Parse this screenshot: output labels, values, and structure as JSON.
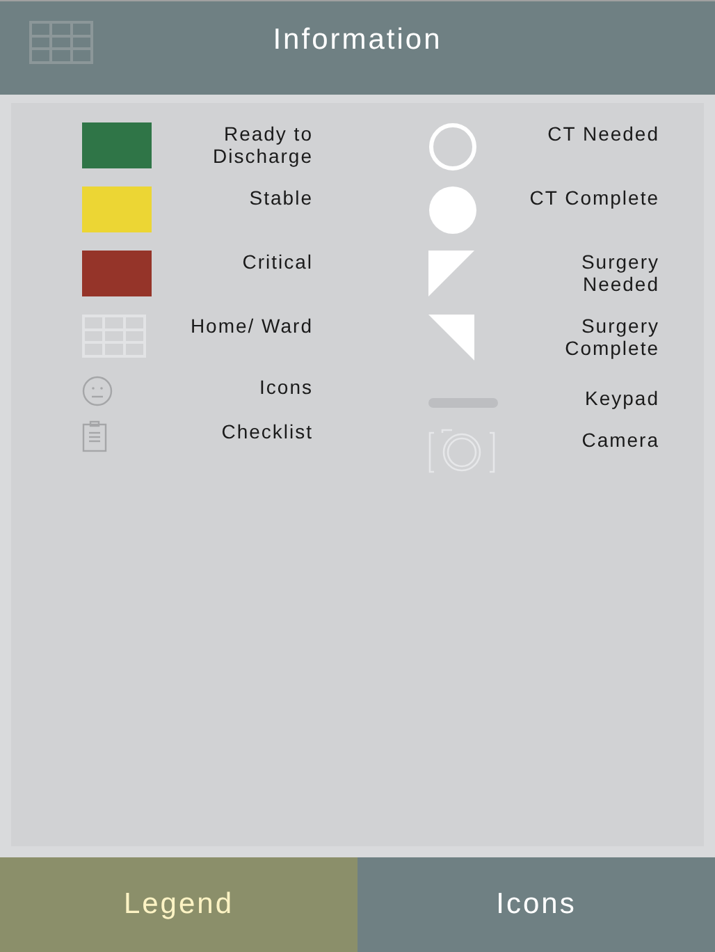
{
  "header": {
    "title": "Information"
  },
  "legend": {
    "left": [
      {
        "kind": "swatch",
        "color": "#2f7547",
        "label": "Ready to Discharge"
      },
      {
        "kind": "swatch",
        "color": "#ecd634",
        "label": "Stable"
      },
      {
        "kind": "swatch",
        "color": "#953429",
        "label": "Critical"
      },
      {
        "kind": "grid",
        "label": "Home/ Ward"
      },
      {
        "kind": "face",
        "label": "Icons"
      },
      {
        "kind": "clipboard",
        "label": "Checklist"
      }
    ],
    "right": [
      {
        "kind": "ring",
        "label": "CT Needed"
      },
      {
        "kind": "disc",
        "label": "CT Complete"
      },
      {
        "kind": "tri-needed",
        "label": "Surgery Needed"
      },
      {
        "kind": "tri-complete",
        "label": "Surgery Complete"
      },
      {
        "kind": "bar",
        "label": "Keypad"
      },
      {
        "kind": "camera",
        "label": "Camera"
      }
    ]
  },
  "tabs": [
    {
      "label": "Legend",
      "selected": true
    },
    {
      "label": "Icons",
      "selected": false
    }
  ]
}
